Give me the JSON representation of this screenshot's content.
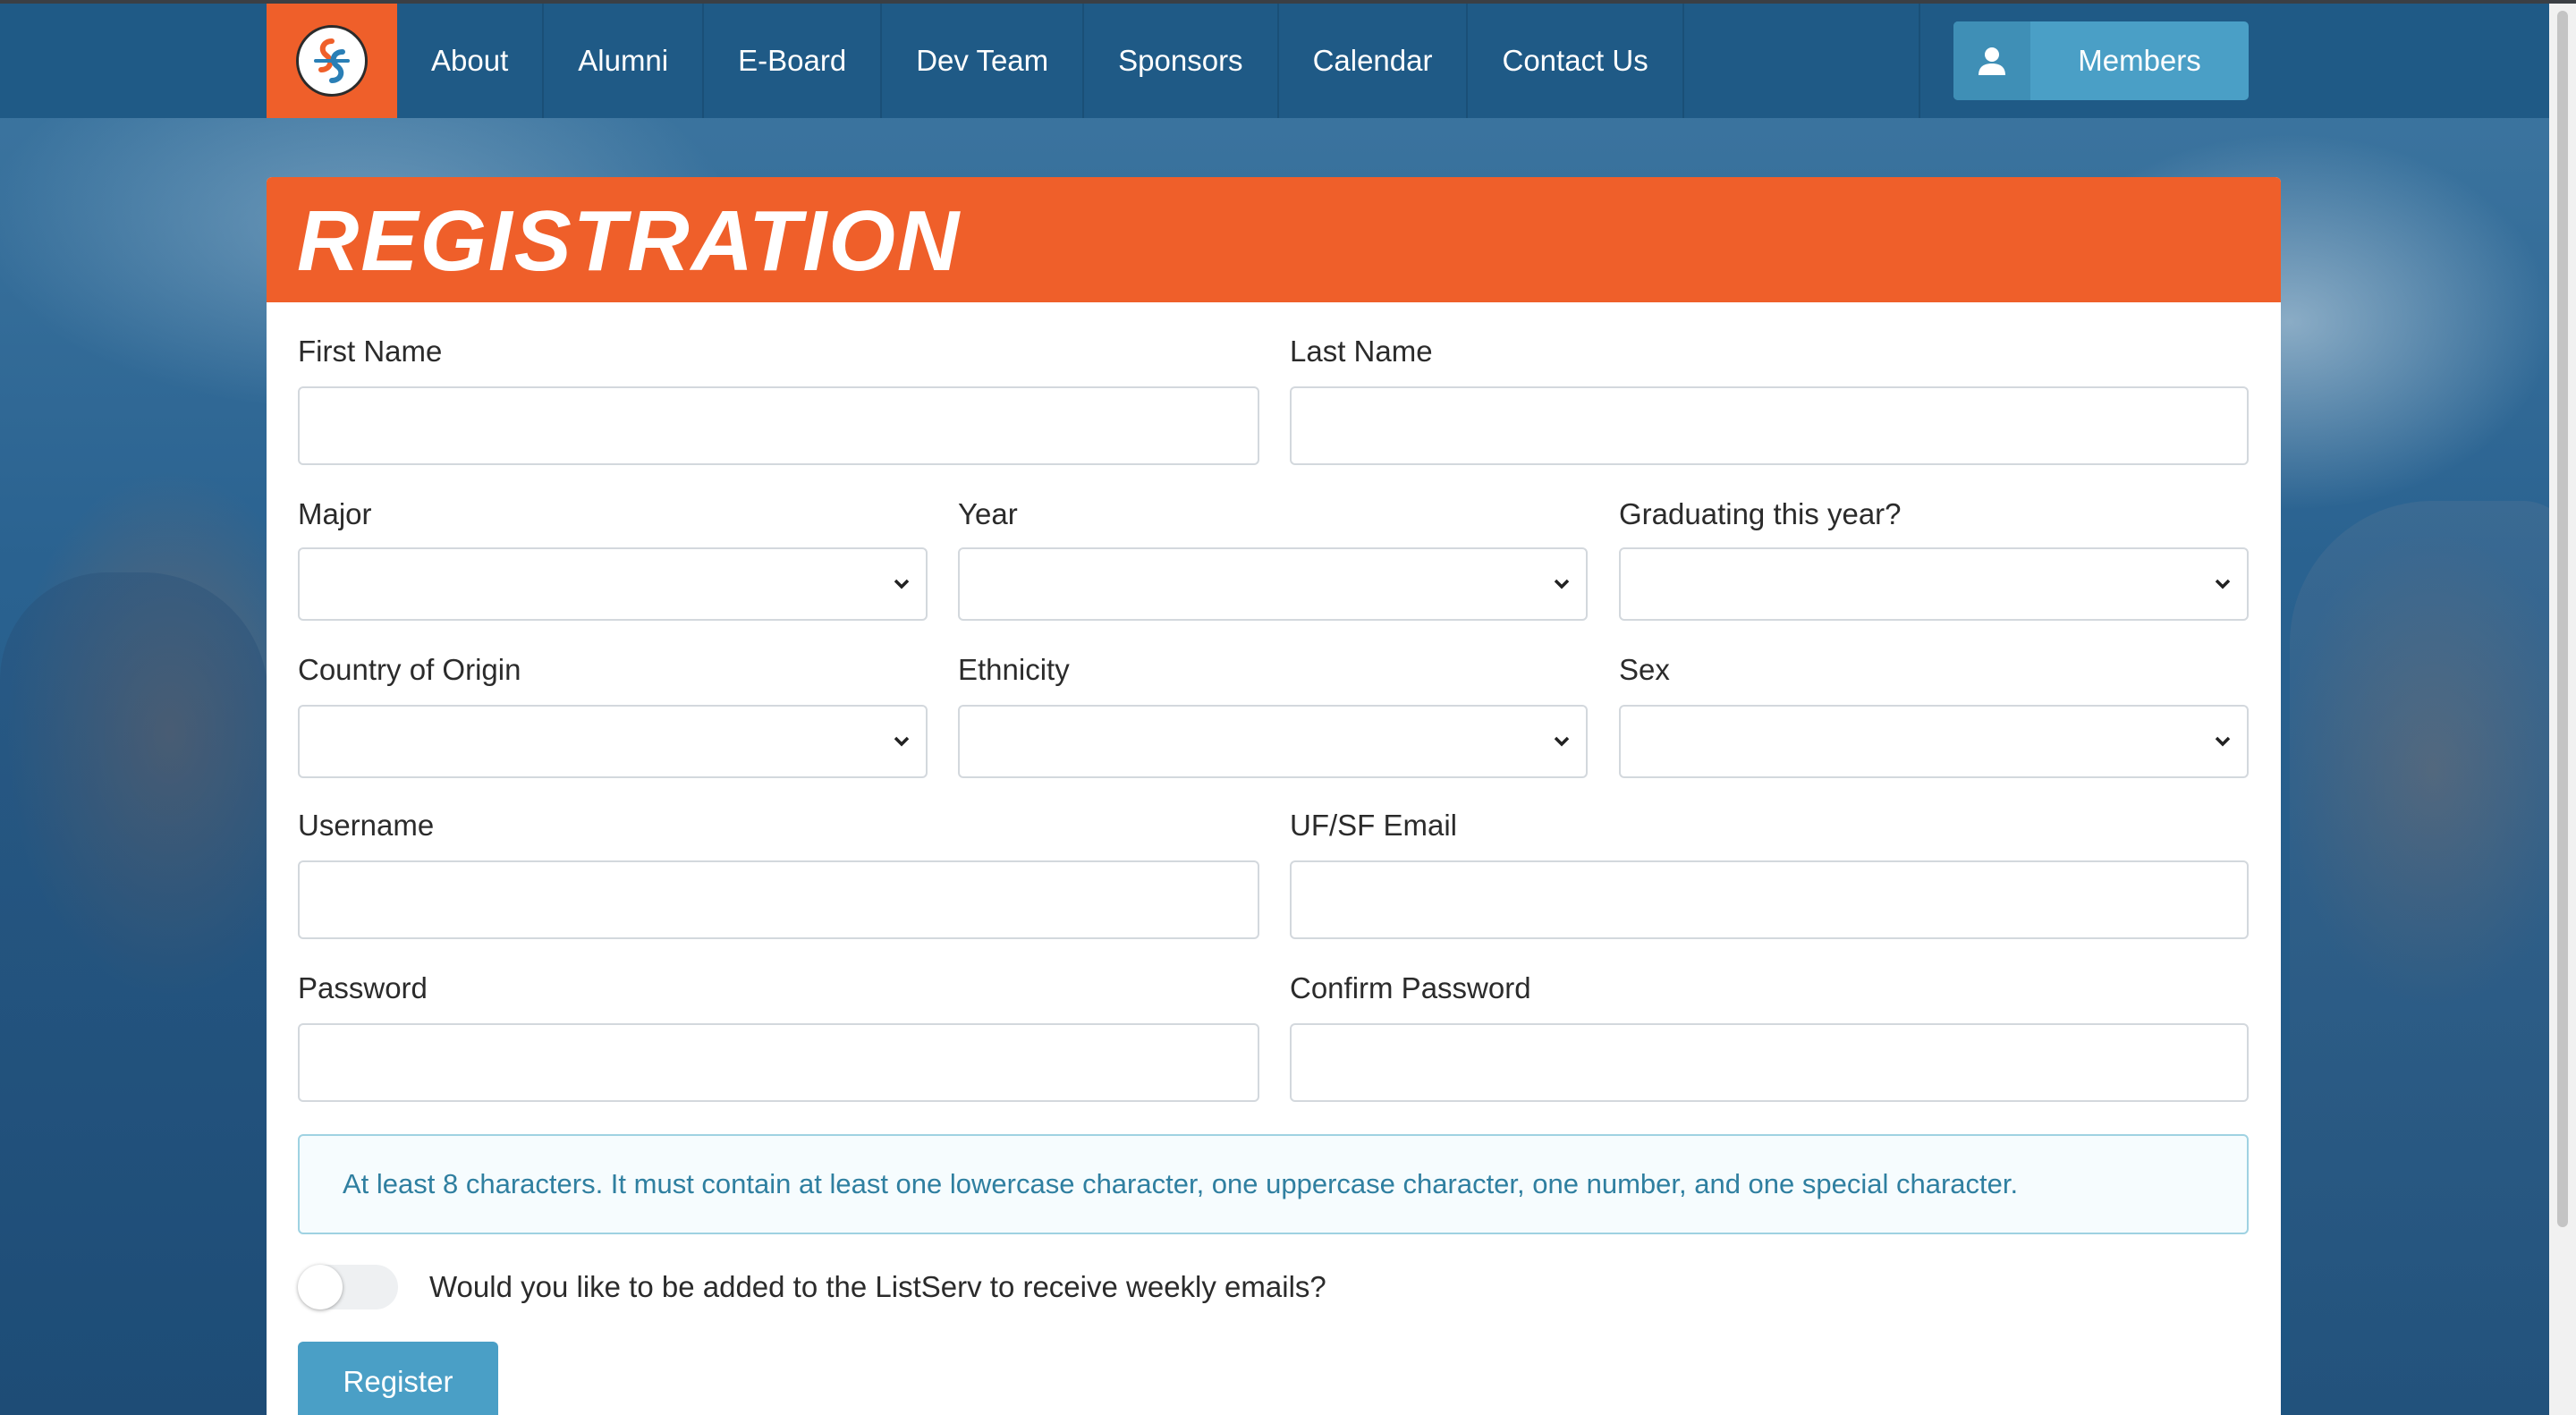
{
  "nav": {
    "items": [
      "About",
      "Alumni",
      "E-Board",
      "Dev Team",
      "Sponsors",
      "Calendar",
      "Contact Us"
    ],
    "members_label": "Members"
  },
  "form": {
    "title": "REGISTRATION",
    "first_name_label": "First Name",
    "last_name_label": "Last Name",
    "major_label": "Major",
    "year_label": "Year",
    "graduating_label": "Graduating this year?",
    "country_label": "Country of Origin",
    "ethnicity_label": "Ethnicity",
    "sex_label": "Sex",
    "username_label": "Username",
    "email_label": "UF/SF Email",
    "password_label": "Password",
    "confirm_password_label": "Confirm Password",
    "password_hint": "At least 8 characters. It must contain at least one lowercase character, one uppercase character, one number, and one special character.",
    "listserv_label": "Would you like to be added to the ListServ to receive weekly emails?",
    "register_label": "Register"
  },
  "colors": {
    "brand_orange": "#ef5f2a",
    "nav_blue": "#1f5a86",
    "button_blue": "#4a9fc6",
    "hint_text": "#2f7fa0"
  },
  "icons": {
    "logo": "org-logo-icon",
    "members": "user-icon",
    "select": "chevron-down-icon"
  }
}
